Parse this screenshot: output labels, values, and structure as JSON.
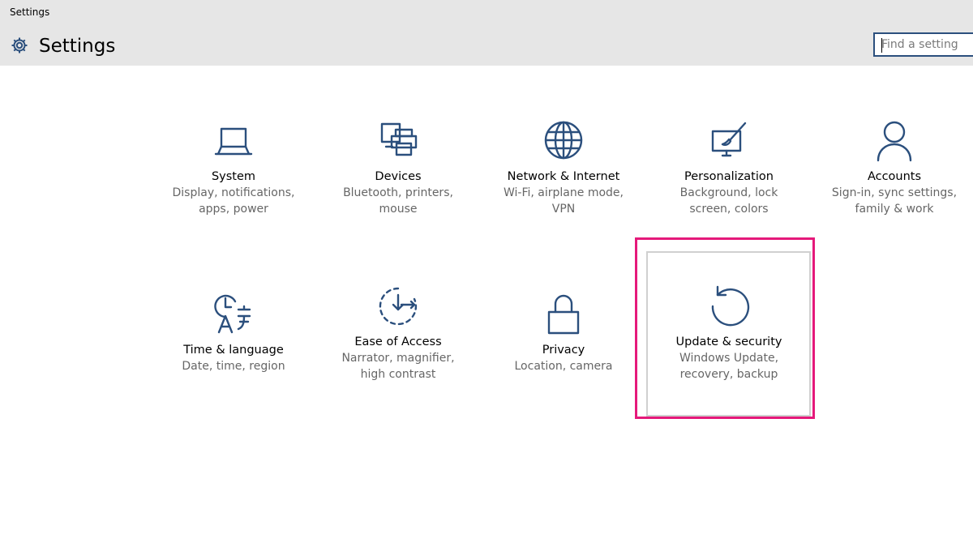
{
  "window": {
    "title": "Settings"
  },
  "header": {
    "title": "Settings",
    "icon": "gear-icon"
  },
  "search": {
    "placeholder": "Find a setting",
    "value": ""
  },
  "colors": {
    "accent": "#2b4f7d",
    "highlight": "#e5197a",
    "header_bg": "#e6e6e6"
  },
  "tiles": [
    {
      "id": "system",
      "icon": "laptop-icon",
      "title": "System",
      "desc": "Display, notifications, apps, power"
    },
    {
      "id": "devices",
      "icon": "devices-icon",
      "title": "Devices",
      "desc": "Bluetooth, printers, mouse"
    },
    {
      "id": "network",
      "icon": "globe-icon",
      "title": "Network & Internet",
      "desc": "Wi-Fi, airplane mode, VPN"
    },
    {
      "id": "personalization",
      "icon": "paint-icon",
      "title": "Personalization",
      "desc": "Background, lock screen, colors"
    },
    {
      "id": "accounts",
      "icon": "person-icon",
      "title": "Accounts",
      "desc": "Sign-in, sync settings, family & work"
    },
    {
      "id": "time",
      "icon": "time-language-icon",
      "title": "Time & language",
      "desc": "Date, time, region"
    },
    {
      "id": "ease",
      "icon": "ease-of-access-icon",
      "title": "Ease of Access",
      "desc": "Narrator, magnifier, high contrast"
    },
    {
      "id": "privacy",
      "icon": "lock-icon",
      "title": "Privacy",
      "desc": "Location, camera"
    },
    {
      "id": "update",
      "icon": "refresh-icon",
      "title": "Update & security",
      "desc": "Windows Update, recovery, backup",
      "selected": true
    }
  ]
}
